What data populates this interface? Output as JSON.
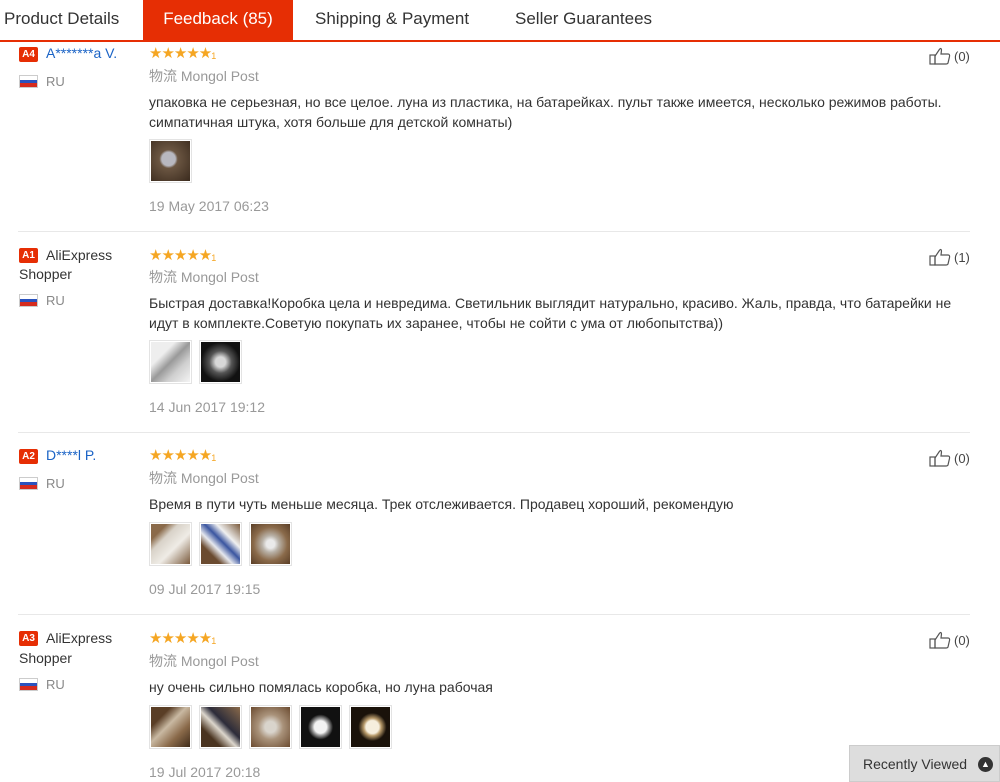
{
  "tabs": [
    {
      "label": "Product Details"
    },
    {
      "label": "Feedback (85)"
    },
    {
      "label": "Shipping & Payment"
    },
    {
      "label": "Seller Guarantees"
    }
  ],
  "reviews": [
    {
      "level": "A4",
      "user": "A*******a V.",
      "country": "RU",
      "stars": "★★★★★",
      "stars_sup": "1",
      "logistics": "物流 Mongol Post",
      "text": "упаковка не серьезная, но все целое. луна из пластика, на батарейках. пульт также имеется, несколько режимов работы. симпатичная штука, хотя больше для детской комнаты)",
      "date": "19 May 2017 06:23",
      "helpful": "(0)"
    },
    {
      "level": "A1",
      "user_line1": "AliExpress",
      "user_line2": "Shopper",
      "country": "RU",
      "stars": "★★★★★",
      "stars_sup": "1",
      "logistics": "物流 Mongol Post",
      "text": "Быстрая доставка!Коробка цела и невредима. Светильник выглядит натурально, красиво. Жаль, правда, что батарейки не идут в комплекте.Советую покупать их заранее, чтобы не сойти с ума от любопытства))",
      "date": "14 Jun 2017 19:12",
      "helpful": "(1)"
    },
    {
      "level": "A2",
      "user": "D****l P.",
      "country": "RU",
      "stars": "★★★★★",
      "stars_sup": "1",
      "logistics": "物流 Mongol Post",
      "text": "Время в пути чуть меньше месяца. Трек отслеживается. Продавец хороший, рекомендую",
      "date": "09 Jul 2017 19:15",
      "helpful": "(0)"
    },
    {
      "level": "A3",
      "user_line1": "AliExpress",
      "user_line2": "Shopper",
      "country": "RU",
      "stars": "★★★★★",
      "stars_sup": "1",
      "logistics": "物流 Mongol Post",
      "text": "ну очень сильно помялась коробка, но луна рабочая",
      "date": "19 Jul 2017 20:18",
      "helpful": "(0)"
    }
  ],
  "recently_viewed": {
    "label": "Recently Viewed",
    "icon": "chevron-up-icon"
  },
  "colors": {
    "accent": "#e62e04",
    "star": "#f5a623",
    "link": "#1a63c6"
  }
}
